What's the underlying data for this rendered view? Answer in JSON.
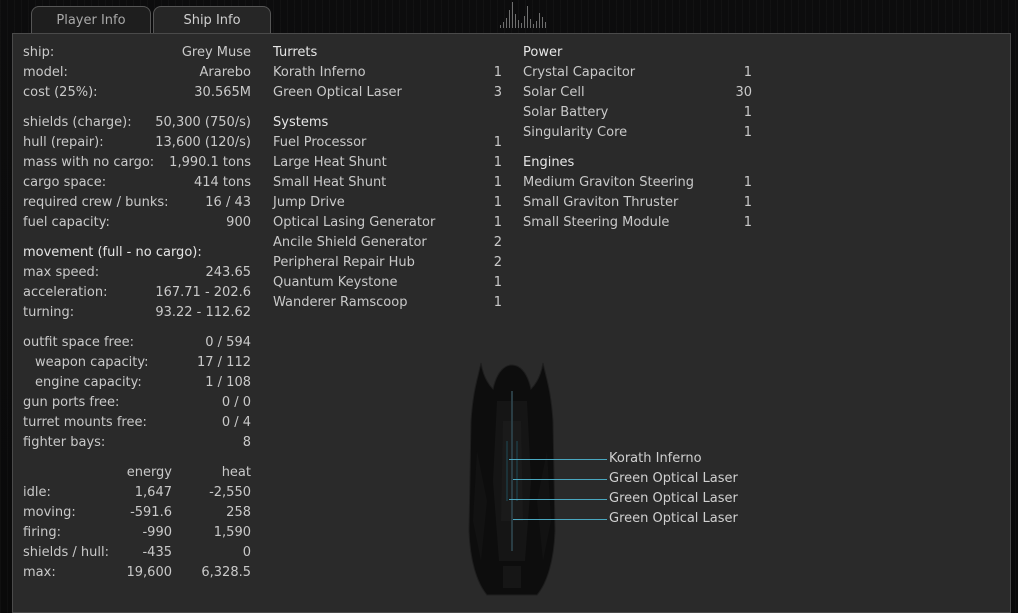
{
  "tabs": [
    {
      "label": "Player Info",
      "active": false
    },
    {
      "label": "Ship Info",
      "active": true
    }
  ],
  "ship_stats": [
    {
      "label": "ship:",
      "value": "Grey Muse"
    },
    {
      "label": "model:",
      "value": "Ararebo"
    },
    {
      "label": "cost (25%):",
      "value": "30.565M"
    },
    {
      "label": "shields (charge):",
      "value": "50,300 (750/s)"
    },
    {
      "label": "hull (repair):",
      "value": "13,600 (120/s)"
    },
    {
      "label": "mass with no cargo:",
      "value": "1,990.1 tons"
    },
    {
      "label": "cargo space:",
      "value": "414 tons"
    },
    {
      "label": "required crew / bunks:",
      "value": "16 / 43"
    },
    {
      "label": "fuel capacity:",
      "value": "900"
    }
  ],
  "movement": {
    "heading": "movement (full - no cargo):",
    "rows": [
      {
        "label": "max speed:",
        "value": "243.65"
      },
      {
        "label": "acceleration:",
        "value": "167.71 - 202.6"
      },
      {
        "label": "turning:",
        "value": "93.22 - 112.62"
      }
    ]
  },
  "capacity": [
    {
      "label": "outfit space free:",
      "value": "0 / 594",
      "indent": false
    },
    {
      "label": "weapon capacity:",
      "value": "17 / 112",
      "indent": true
    },
    {
      "label": "engine capacity:",
      "value": "1 / 108",
      "indent": true
    },
    {
      "label": "gun ports free:",
      "value": "0 / 0",
      "indent": false
    },
    {
      "label": "turret mounts free:",
      "value": "0 / 4",
      "indent": false
    },
    {
      "label": "fighter bays:",
      "value": "8",
      "indent": false
    }
  ],
  "energy_heat": {
    "col_energy": "energy",
    "col_heat": "heat",
    "rows": [
      {
        "label": "idle:",
        "energy": "1,647",
        "heat": "-2,550"
      },
      {
        "label": "moving:",
        "energy": "-591.6",
        "heat": "258"
      },
      {
        "label": "firing:",
        "energy": "-990",
        "heat": "1,590"
      },
      {
        "label": "shields / hull:",
        "energy": "-435",
        "heat": "0"
      },
      {
        "label": "max:",
        "energy": "19,600",
        "heat": "6,328.5"
      }
    ]
  },
  "outfits_col1": [
    {
      "heading": "Turrets",
      "items": [
        {
          "name": "Korath Inferno",
          "count": "1"
        },
        {
          "name": "Green Optical Laser",
          "count": "3"
        }
      ]
    },
    {
      "heading": "Systems",
      "items": [
        {
          "name": "Fuel Processor",
          "count": "1"
        },
        {
          "name": "Large Heat Shunt",
          "count": "1"
        },
        {
          "name": "Small Heat Shunt",
          "count": "1"
        },
        {
          "name": "Jump Drive",
          "count": "1"
        },
        {
          "name": "Optical Lasing Generator",
          "count": "1"
        },
        {
          "name": "Ancile Shield Generator",
          "count": "2"
        },
        {
          "name": "Peripheral Repair Hub",
          "count": "2"
        },
        {
          "name": "Quantum Keystone",
          "count": "1"
        },
        {
          "name": "Wanderer Ramscoop",
          "count": "1"
        }
      ]
    }
  ],
  "outfits_col2": [
    {
      "heading": "Power",
      "items": [
        {
          "name": "Crystal Capacitor",
          "count": "1"
        },
        {
          "name": "Solar Cell",
          "count": "30"
        },
        {
          "name": "Solar Battery",
          "count": "1"
        },
        {
          "name": "Singularity Core",
          "count": "1"
        }
      ]
    },
    {
      "heading": "Engines",
      "items": [
        {
          "name": "Medium Graviton Steering",
          "count": "1"
        },
        {
          "name": "Small Graviton Thruster",
          "count": "1"
        },
        {
          "name": "Small Steering Module",
          "count": "1"
        }
      ]
    }
  ],
  "hardpoints": [
    "Korath Inferno",
    "Green Optical Laser",
    "Green Optical Laser",
    "Green Optical Laser"
  ],
  "colors": {
    "accent_line": "#4aa7bf",
    "panel": "#2a2a2a",
    "text": "#c9c9c9"
  }
}
